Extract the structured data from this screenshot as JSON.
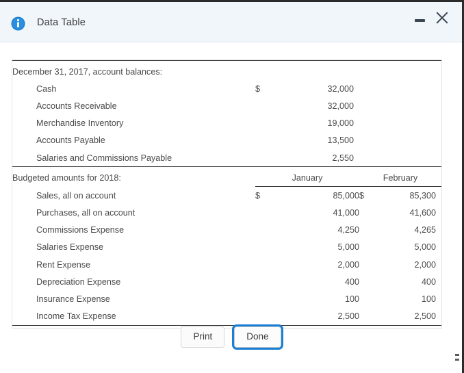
{
  "window": {
    "title": "Data Table",
    "icon": "info-icon",
    "minimize_label": "Minimize",
    "close_label": "Close"
  },
  "table": {
    "section1": {
      "heading": "December 31, 2017, account balances:",
      "rows": [
        {
          "label": "Cash",
          "currency": "$",
          "value": "32,000"
        },
        {
          "label": "Accounts Receivable",
          "currency": "",
          "value": "32,000"
        },
        {
          "label": "Merchandise Inventory",
          "currency": "",
          "value": "19,000"
        },
        {
          "label": "Accounts Payable",
          "currency": "",
          "value": "13,500"
        },
        {
          "label": "Salaries and Commissions Payable",
          "currency": "",
          "value": "2,550"
        }
      ]
    },
    "section2": {
      "heading": "Budgeted amounts for 2018:",
      "columns": [
        "January",
        "February"
      ],
      "rows": [
        {
          "label": "Sales, all on account",
          "cur1": "$",
          "jan": "85,000",
          "cur2": "$",
          "feb": "85,300"
        },
        {
          "label": "Purchases, all on account",
          "cur1": "",
          "jan": "41,000",
          "cur2": "",
          "feb": "41,600"
        },
        {
          "label": "Commissions Expense",
          "cur1": "",
          "jan": "4,250",
          "cur2": "",
          "feb": "4,265"
        },
        {
          "label": "Salaries Expense",
          "cur1": "",
          "jan": "5,000",
          "cur2": "",
          "feb": "5,000"
        },
        {
          "label": "Rent Expense",
          "cur1": "",
          "jan": "2,000",
          "cur2": "",
          "feb": "2,000"
        },
        {
          "label": "Depreciation Expense",
          "cur1": "",
          "jan": "400",
          "cur2": "",
          "feb": "400"
        },
        {
          "label": "Insurance Expense",
          "cur1": "",
          "jan": "100",
          "cur2": "",
          "feb": "100"
        },
        {
          "label": "Income Tax Expense",
          "cur1": "",
          "jan": "2,500",
          "cur2": "",
          "feb": "2,500"
        }
      ]
    }
  },
  "footer": {
    "print_label": "Print",
    "done_label": "Done"
  },
  "colors": {
    "titlebar_bg": "#f1f6fb",
    "info_blue": "#1c7fd0",
    "focus_ring": "#1a7fd4",
    "text": "#4a4a4a",
    "rule": "#2f2f2f"
  }
}
